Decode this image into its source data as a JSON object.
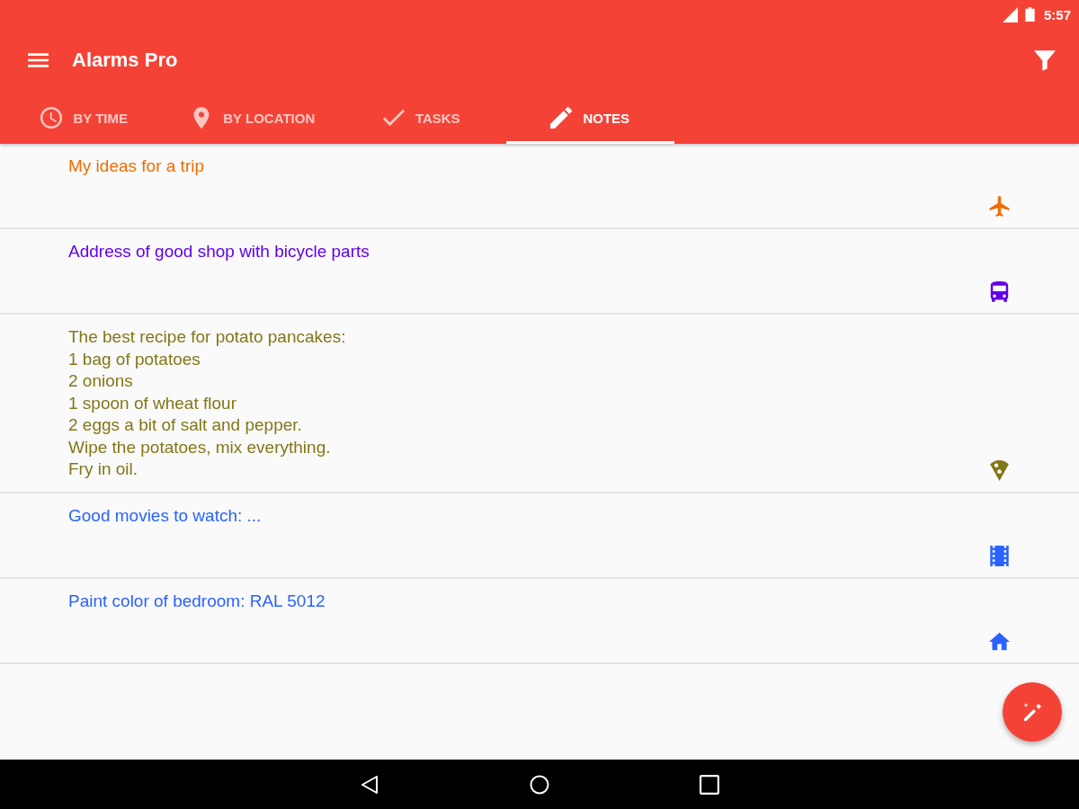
{
  "status_bar": {
    "time": "5:57"
  },
  "toolbar": {
    "title": "Alarms Pro"
  },
  "tabs": [
    {
      "label": "BY TIME",
      "kind": "time",
      "selected": false
    },
    {
      "label": "BY LOCATION",
      "kind": "location",
      "selected": false
    },
    {
      "label": "TASKS",
      "kind": "tasks",
      "selected": false
    },
    {
      "label": "NOTES",
      "kind": "notes",
      "selected": true
    }
  ],
  "notes": [
    {
      "text": "My ideas for a trip",
      "kind": "flight",
      "color": "#ef6c00"
    },
    {
      "text": "Address of good shop with bicycle parts",
      "kind": "bus",
      "color": "#6200ea"
    },
    {
      "text": "The best recipe for potato pancakes:\n1 bag of potatoes\n2 onions\n1 spoon of wheat flour\n2 eggs a bit of salt and pepper.\nWipe the potatoes, mix everything.\nFry in oil.",
      "kind": "pizza",
      "color": "#827717"
    },
    {
      "text": "Good movies to watch: ...",
      "kind": "movie",
      "color": "#2962ff"
    },
    {
      "text": "Paint color of bedroom: RAL 5012",
      "kind": "home",
      "color": "#2962ff"
    }
  ]
}
